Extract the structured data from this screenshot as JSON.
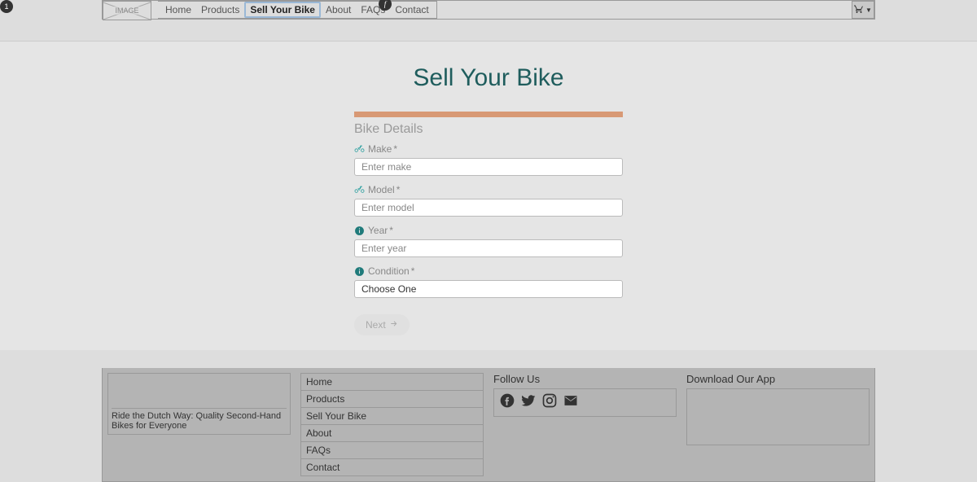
{
  "badges": {
    "one": "1",
    "f": "f"
  },
  "logo_text": "IMAGE",
  "nav": {
    "items": [
      {
        "label": "Home",
        "active": false
      },
      {
        "label": "Products",
        "active": false
      },
      {
        "label": "Sell Your Bike",
        "active": true
      },
      {
        "label": "About",
        "active": false
      },
      {
        "label": "FAQs",
        "active": false
      },
      {
        "label": "Contact",
        "active": false
      }
    ]
  },
  "cart_glyph": "🛒▾",
  "page": {
    "title": "Sell Your Bike",
    "section_title": "Bike Details",
    "fields": {
      "make": {
        "label": "Make",
        "placeholder": "Enter make",
        "required": "*"
      },
      "model": {
        "label": "Model",
        "placeholder": "Enter model",
        "required": "*"
      },
      "year": {
        "label": "Year",
        "placeholder": "Enter year",
        "required": "*"
      },
      "condition": {
        "label": "Condition",
        "placeholder": "Choose One",
        "required": "*"
      }
    },
    "next_label": "Next"
  },
  "footer": {
    "tagline": "Ride the Dutch Way: Quality Second-Hand Bikes for Everyone",
    "nav": [
      "Home",
      "Products",
      "Sell Your Bike",
      "About",
      "FAQs",
      "Contact"
    ],
    "follow_title": "Follow Us",
    "download_title": "Download Our App"
  }
}
